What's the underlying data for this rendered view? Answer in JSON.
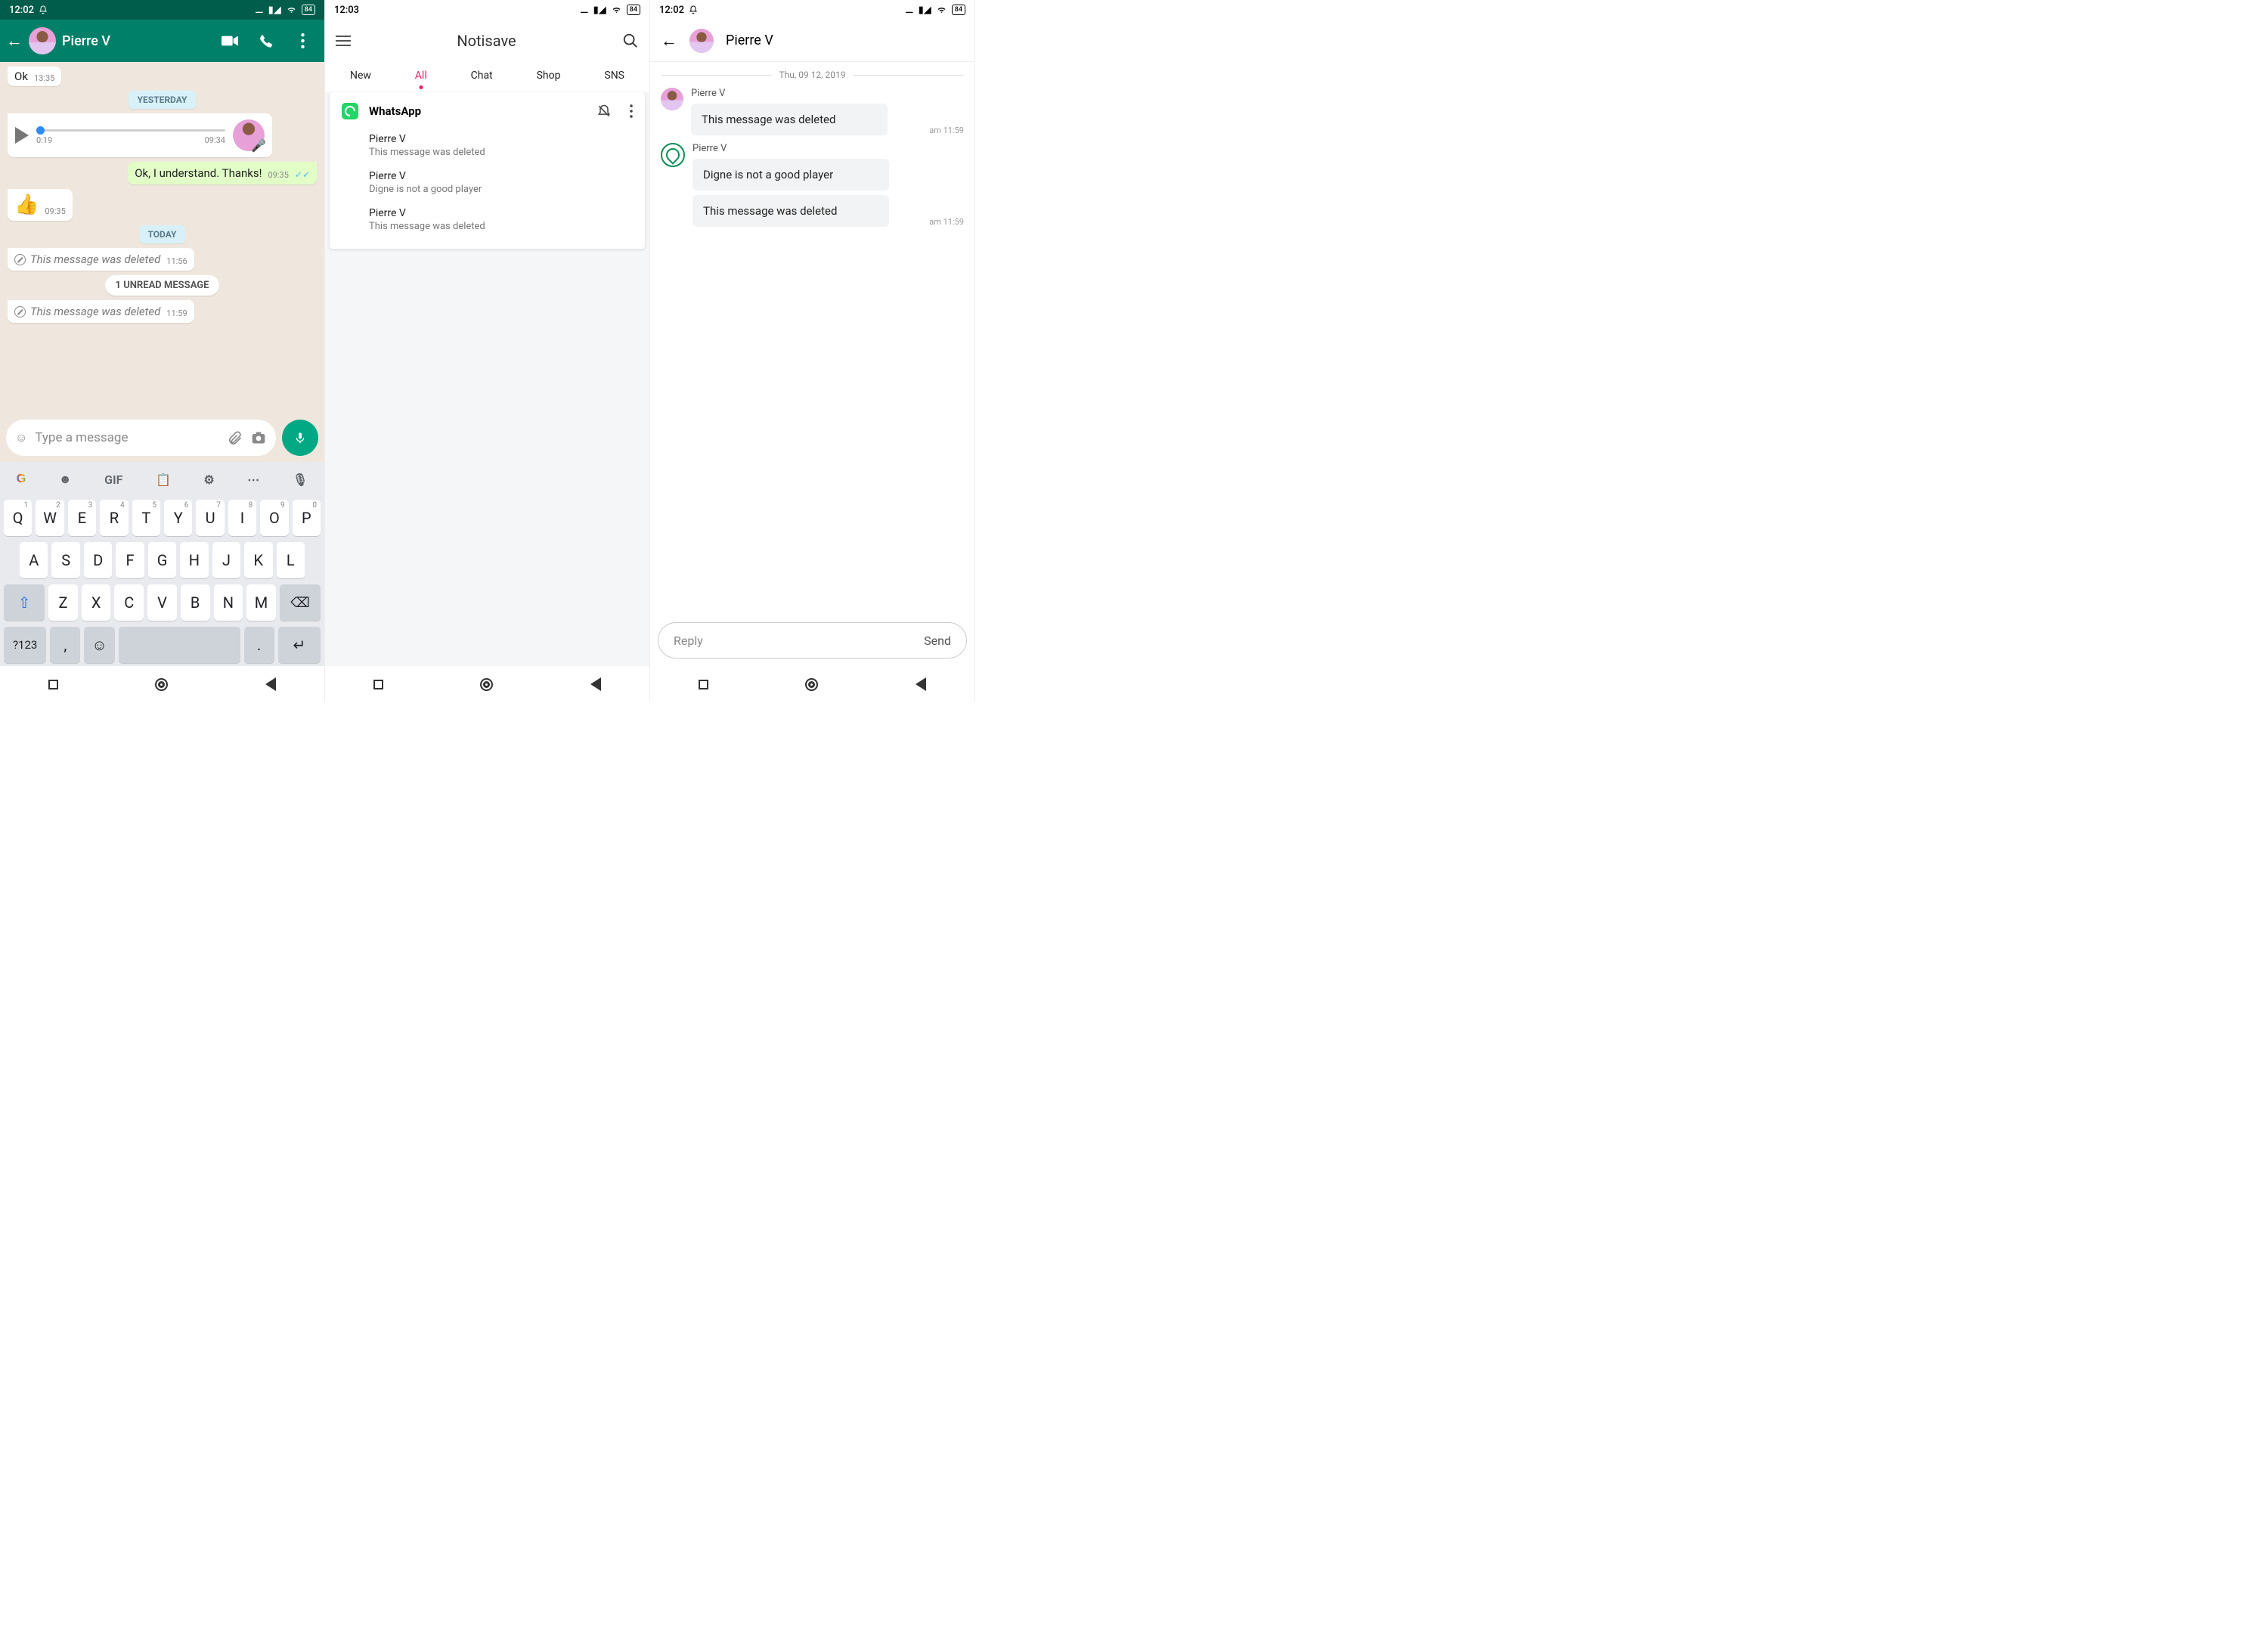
{
  "phone1": {
    "status": {
      "time": "12:02",
      "battery": "84"
    },
    "contact": "Pierre V",
    "msg_ok": "Ok",
    "msg_ok_time": "13:35",
    "sep_yesterday": "YESTERDAY",
    "voice": {
      "dur": "0:19",
      "time": "09:34"
    },
    "msg_thanks": "Ok, I understand. Thanks!",
    "msg_thanks_time": "09:35",
    "emoji_time": "09:35",
    "sep_today": "TODAY",
    "deleted_text": "This message was deleted",
    "del1_time": "11:56",
    "unread": "1 UNREAD MESSAGE",
    "del2_time": "11:59",
    "input_placeholder": "Type a message",
    "kb_rows": {
      "r1": [
        [
          "Q",
          "1"
        ],
        [
          "W",
          "2"
        ],
        [
          "E",
          "3"
        ],
        [
          "R",
          "4"
        ],
        [
          "T",
          "5"
        ],
        [
          "Y",
          "6"
        ],
        [
          "U",
          "7"
        ],
        [
          "I",
          "8"
        ],
        [
          "O",
          "9"
        ],
        [
          "P",
          "0"
        ]
      ],
      "r2": [
        "A",
        "S",
        "D",
        "F",
        "G",
        "H",
        "J",
        "K",
        "L"
      ],
      "r3": [
        "Z",
        "X",
        "C",
        "V",
        "B",
        "N",
        "M"
      ],
      "sym": "?123",
      "gif": "GIF"
    }
  },
  "phone2": {
    "status": {
      "time": "12:03",
      "battery": "84"
    },
    "title": "Notisave",
    "tabs": {
      "new": "New",
      "all": "All",
      "chat": "Chat",
      "shop": "Shop",
      "sns": "SNS"
    },
    "card": {
      "app": "WhatsApp",
      "items": [
        {
          "sender": "Pierre V",
          "msg": "This message was deleted"
        },
        {
          "sender": "Pierre V",
          "msg": "Digne is not a good player"
        },
        {
          "sender": "Pierre V",
          "msg": "This message was deleted"
        }
      ]
    }
  },
  "phone3": {
    "status": {
      "time": "12:02",
      "battery": "84"
    },
    "contact": "Pierre V",
    "date": "Thu, 09 12, 2019",
    "grp1": {
      "name": "Pierre V",
      "msgs": [
        "This message was deleted"
      ],
      "time": "am 11:59"
    },
    "grp2": {
      "name": "Pierre V",
      "msgs": [
        "Digne is not a good player",
        "This message was deleted"
      ],
      "time": "am 11:59"
    },
    "reply_ph": "Reply",
    "send": "Send"
  }
}
